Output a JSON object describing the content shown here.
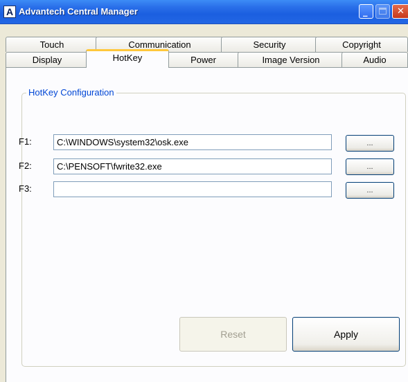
{
  "window": {
    "title": "Advantech Central Manager",
    "app_icon": "A",
    "controls": {
      "minimize": "_",
      "close": "✕"
    }
  },
  "tabs": {
    "top_row": [
      "Touch",
      "Communication",
      "Security",
      "Copyright"
    ],
    "bottom_row": [
      "Display",
      "HotKey",
      "Power",
      "Image Version",
      "Audio"
    ],
    "active": "HotKey"
  },
  "hotkey": {
    "group_title": "HotKey Configuration",
    "rows": [
      {
        "label": "F1:",
        "value": "C:\\WINDOWS\\system32\\osk.exe",
        "browse": "..."
      },
      {
        "label": "F2:",
        "value": "C:\\PENSOFT\\fwrite32.exe",
        "browse": "..."
      },
      {
        "label": "F3:",
        "value": "",
        "browse": "..."
      }
    ],
    "reset_label": "Reset",
    "apply_label": "Apply"
  }
}
